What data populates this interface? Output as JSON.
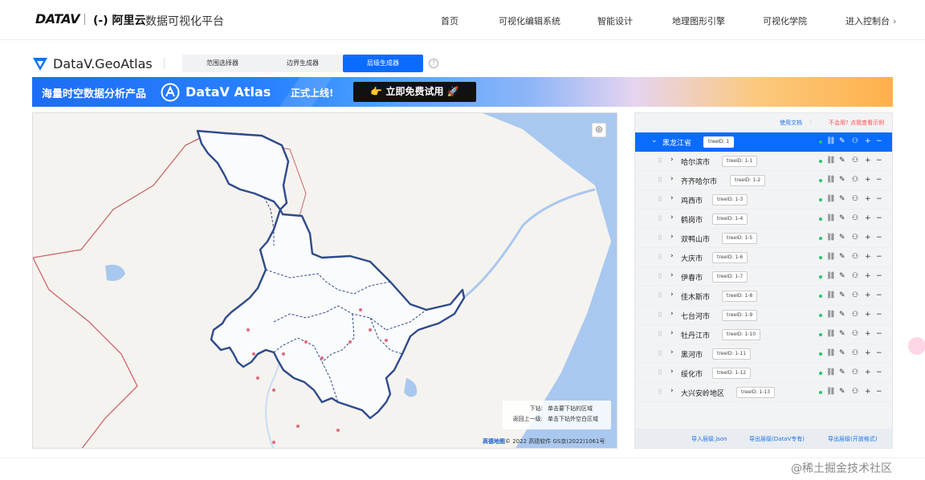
{
  "topnav": {
    "logo_text": "DATAV",
    "aliyun_text": "(-) 阿里云",
    "site_title": "数据可视化平台",
    "items": [
      "首页",
      "可视化编辑系统",
      "智能设计",
      "地理图形引擎",
      "可视化学院",
      "进入控制台"
    ],
    "console_arrow": "›"
  },
  "subhead": {
    "title": "DataV.GeoAtlas",
    "tabs": [
      "范围选择器",
      "边界生成器",
      "层级生成器"
    ],
    "active_tab": 2,
    "help": "?"
  },
  "banner": {
    "left_text": "海量时空数据分析产品",
    "brand": "DataV Atlas",
    "launch_text": "正式上线!",
    "cta": "👉 立即免费试用 🚀"
  },
  "map": {
    "tips": [
      {
        "key": "下钻:",
        "value": "单击要下钻的区域"
      },
      {
        "key": "返回上一级:",
        "value": "单击下钻外空白区域"
      }
    ],
    "copyright_brand": "高德地图",
    "copyright": "© 2022 高德软件 GS京(2022)1061号",
    "locate_icon": "◎"
  },
  "panel": {
    "doc_link": "使用文档",
    "demo_link": "不会用? 点我查看示例",
    "root": {
      "name": "黑龙江省",
      "tree_id": "treeID: 1"
    },
    "children": [
      {
        "name": "哈尔滨市",
        "tree_id": "treeID: 1-1"
      },
      {
        "name": "齐齐哈尔市",
        "tree_id": "treeID: 1-2"
      },
      {
        "name": "鸡西市",
        "tree_id": "treeID: 1-3"
      },
      {
        "name": "鹤岗市",
        "tree_id": "treeID: 1-4"
      },
      {
        "name": "双鸭山市",
        "tree_id": "treeID: 1-5"
      },
      {
        "name": "大庆市",
        "tree_id": "treeID: 1-6"
      },
      {
        "name": "伊春市",
        "tree_id": "treeID: 1-7"
      },
      {
        "name": "佳木斯市",
        "tree_id": "treeID: 1-8"
      },
      {
        "name": "七台河市",
        "tree_id": "treeID: 1-9"
      },
      {
        "name": "牡丹江市",
        "tree_id": "treeID: 1-10"
      },
      {
        "name": "黑河市",
        "tree_id": "treeID: 1-11"
      },
      {
        "name": "绥化市",
        "tree_id": "treeID: 1-12"
      },
      {
        "name": "大兴安岭地区",
        "tree_id": "treeID: 1-13"
      }
    ],
    "footer": [
      "导入层级.json",
      "导出层级(DataV专有)",
      "导出层级(开放格式)"
    ]
  },
  "watermark": "@稀土掘金技术社区",
  "colors": {
    "primary": "#0a6cff",
    "boundary": "#2e4a8c",
    "status": "#29c46b"
  }
}
